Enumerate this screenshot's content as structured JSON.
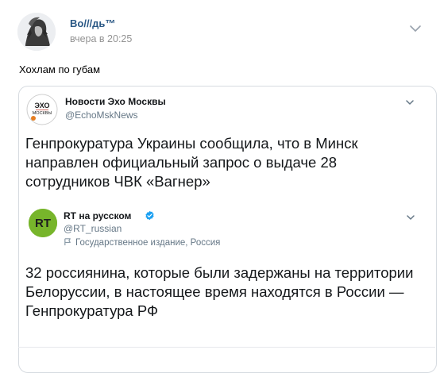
{
  "post": {
    "author": "Во///дь™",
    "time": "вчера в 20:25",
    "text": "Хохлам по губам"
  },
  "tweet": {
    "name": "Новости Эхо Москвы",
    "handle": "@EchoMskNews",
    "logo_text_top": "ЭХО",
    "logo_text_bottom": "МОСКВЫ",
    "text": "Генпрокуратура Украины сообщила, что в Минск направлен официальный запрос о выдаче 28 сотрудников ЧВК «Вагнер»"
  },
  "quoted_tweet": {
    "name": "RT на русском",
    "handle": "@RT_russian",
    "label": "Государственное издание, Россия",
    "logo_text": "RT",
    "text": "32 россиянина, которые были задержаны на территории Белоруссии, в настоящее время находятся в России — Генпрокуратура РФ"
  },
  "colors": {
    "author_link": "#2a5885",
    "rt_green": "#77b52b",
    "verified_blue": "#1da1f2"
  }
}
